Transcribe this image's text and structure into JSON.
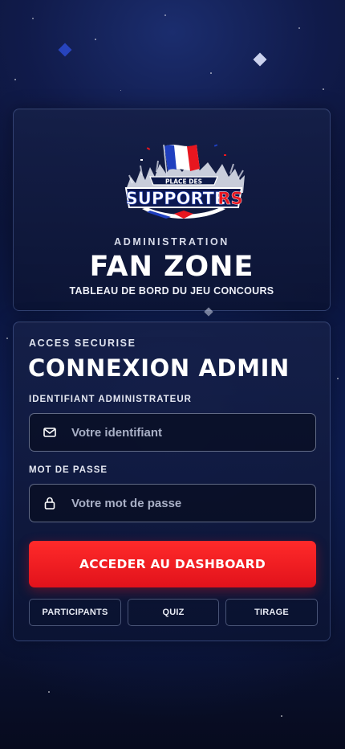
{
  "hero": {
    "logo_text": "PLACE DES SUPPORTERS",
    "label": "ADMINISTRATION",
    "title": "FAN ZONE",
    "subtitle": "TABLEAU DE BORD DU JEU CONCOURS"
  },
  "login": {
    "kicker": "ACCES SECURISE",
    "title": "CONNEXION ADMIN",
    "username": {
      "label": "IDENTIFIANT ADMINISTRATEUR",
      "placeholder": "Votre identifiant",
      "value": "",
      "icon": "mail-icon"
    },
    "password": {
      "label": "MOT DE PASSE",
      "placeholder": "Votre mot de passe",
      "value": "",
      "icon": "lock-icon"
    },
    "submit_label": "ACCEDER AU DASHBOARD"
  },
  "nav": {
    "participants": "PARTICIPANTS",
    "quiz": "QUIZ",
    "tirage": "TIRAGE"
  },
  "colors": {
    "accent_red": "#e8161f",
    "flag_blue": "#1f3fbf",
    "background": "#0b1333"
  }
}
